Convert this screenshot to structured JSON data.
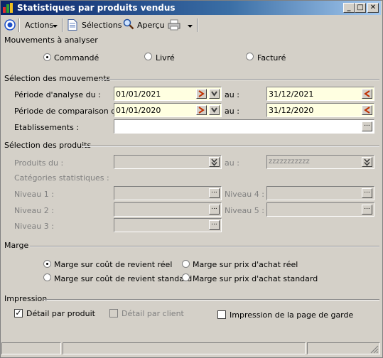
{
  "window": {
    "title": "Statistiques par produits vendus",
    "controls": {
      "minimize": "_",
      "maximize": "□",
      "close": "✕"
    }
  },
  "toolbar": {
    "actions_label": "Actions",
    "selections_label": "Sélections",
    "apercu_label": "Aperçu"
  },
  "mouvements": {
    "title": "Mouvements à analyser",
    "options": [
      "Commandé",
      "Livré",
      "Facturé"
    ],
    "selected": "Commandé"
  },
  "selection_mouvements": {
    "title": "Sélection des mouvements",
    "periode_analyse_label": "Période d'analyse du :",
    "periode_analyse_from": "01/01/2021",
    "periode_analyse_to": "31/12/2021",
    "periode_comparaison_label": "Période de comparaison du :",
    "periode_comparaison_from": "01/01/2020",
    "periode_comparaison_to": "31/12/2020",
    "au_label": "au :",
    "etablissements_label": "Etablissements :",
    "etablissements_value": ""
  },
  "selection_produits": {
    "title": "Sélection des produits",
    "produits_du_label": "Produits du :",
    "produits_du_value": "",
    "au_label": "au :",
    "produits_au_value": "zzzzzzzzzzz",
    "categories_label": "Catégories statistiques :",
    "niveau1_label": "Niveau 1 :",
    "niveau2_label": "Niveau 2 :",
    "niveau3_label": "Niveau 3 :",
    "niveau4_label": "Niveau 4 :",
    "niveau5_label": "Niveau 5 :"
  },
  "marge": {
    "title": "Marge",
    "options": [
      "Marge sur coût de revient réel",
      "Marge sur prix d'achat réel",
      "Marge sur coût de revient standard",
      "Marge sur prix d'achat standard"
    ],
    "selected": "Marge sur coût de revient réel"
  },
  "impression": {
    "title": "Impression",
    "detail_produit_label": "Détail par produit",
    "detail_produit_checked": true,
    "detail_client_label": "Détail par client",
    "detail_client_checked": false,
    "page_garde_label": "Impression de la page de garde",
    "page_garde_checked": false
  },
  "ellipsis": "..."
}
